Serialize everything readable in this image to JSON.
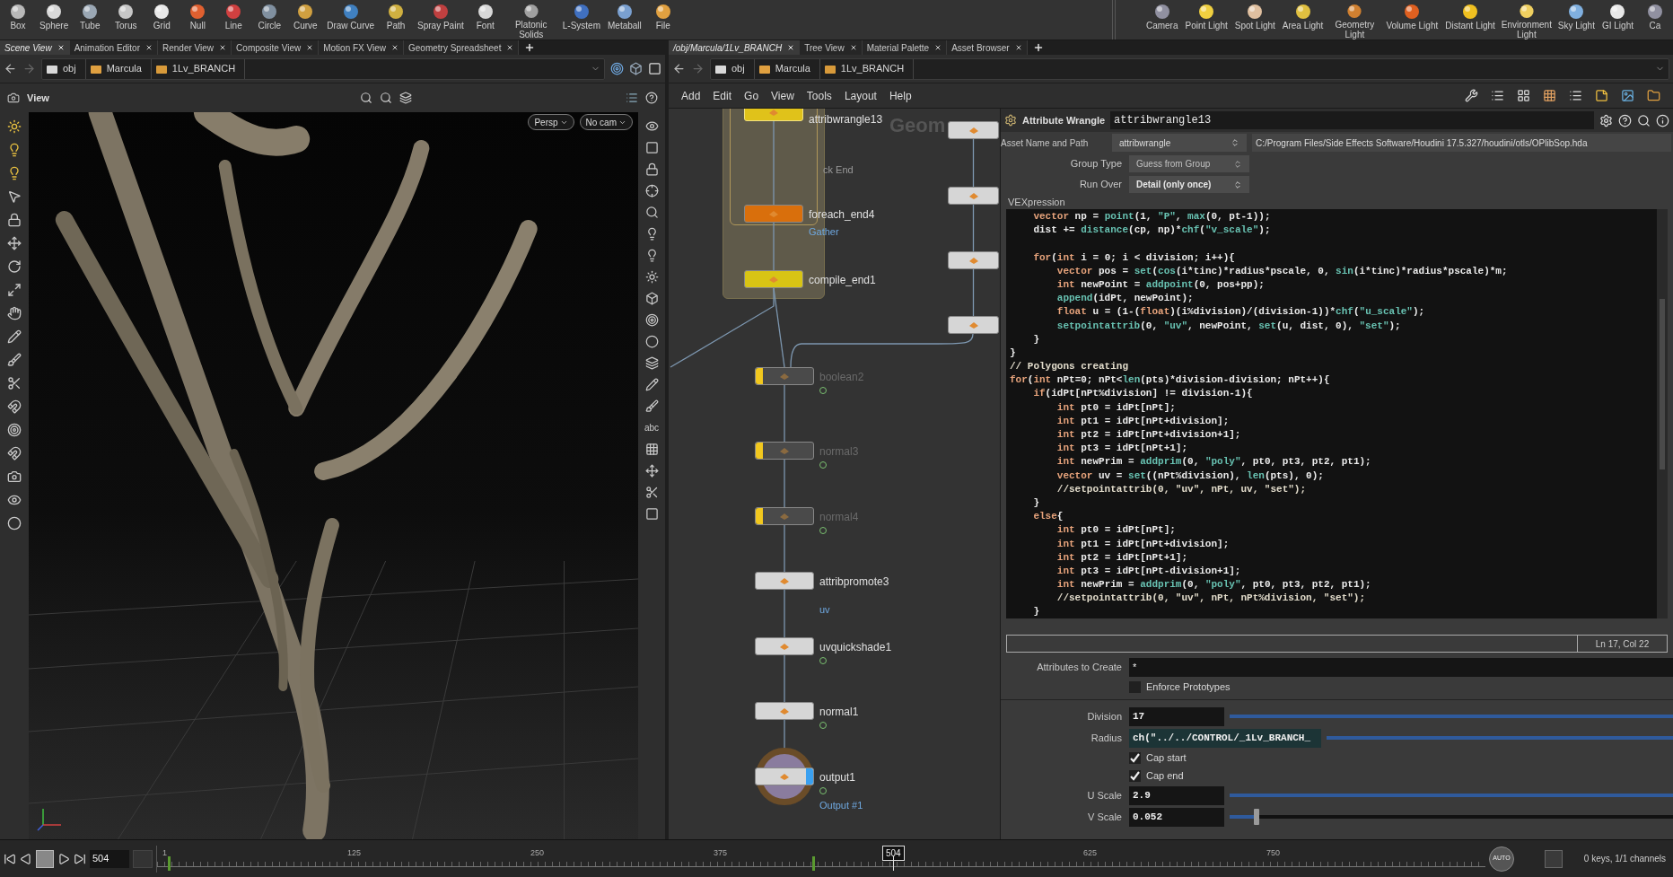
{
  "shelf": {
    "tools": [
      "Box",
      "Sphere",
      "Tube",
      "Torus",
      "Grid",
      "Null",
      "Line",
      "Circle",
      "Curve",
      "Draw Curve",
      "Path",
      "Spray Paint",
      "Font",
      "Platonic Solids",
      "L-System",
      "Metaball",
      "File"
    ],
    "lights": [
      "Camera",
      "Point Light",
      "Spot Light",
      "Area Light",
      "Geometry Light",
      "Volume Light",
      "Distant Light",
      "Environment Light",
      "Sky Light",
      "GI Light",
      "Ca"
    ]
  },
  "scene_view": {
    "tabs": [
      {
        "label": "Scene View",
        "selected": true
      },
      {
        "label": "Animation Editor",
        "selected": false
      },
      {
        "label": "Render View",
        "selected": false
      },
      {
        "label": "Composite View",
        "selected": false
      },
      {
        "label": "Motion FX View",
        "selected": false
      },
      {
        "label": "Geometry Spreadsheet",
        "selected": false
      }
    ],
    "path": [
      "obj",
      "Marcula",
      "1Lv_BRANCH"
    ],
    "pane_title": "View",
    "viewport_buttons": [
      "Persp",
      "No cam"
    ],
    "toolbar_text": "abc"
  },
  "network": {
    "tabs": [
      {
        "label": "/obj/Marcula/1Lv_BRANCH",
        "selected": true
      },
      {
        "label": "Tree View",
        "selected": false
      },
      {
        "label": "Material Palette",
        "selected": false
      },
      {
        "label": "Asset Browser",
        "selected": false
      }
    ],
    "path": [
      "obj",
      "Marcula",
      "1Lv_BRANCH"
    ],
    "menu": [
      "Add",
      "Edit",
      "Go",
      "View",
      "Tools",
      "Layout",
      "Help"
    ],
    "network_title": "Geom",
    "partial_label": "ck End",
    "nodes": [
      {
        "name": "attribwrangle13",
        "color": "#e0c21a",
        "bypassed": false,
        "display": false
      },
      {
        "name": "foreach_end4",
        "sublabel": "Gather",
        "color": "#d96f0c",
        "bypassed": false,
        "display": false
      },
      {
        "name": "compile_end1",
        "color": "#d8c414",
        "bypassed": false,
        "display": false
      },
      {
        "name": "boolean2",
        "color": "#4a4a4a",
        "bypassed": true,
        "display": false
      },
      {
        "name": "normal3",
        "color": "#4a4a4a",
        "bypassed": true,
        "display": false
      },
      {
        "name": "normal4",
        "color": "#4a4a4a",
        "bypassed": true,
        "display": false
      },
      {
        "name": "attribpromote3",
        "sublabel": "uv",
        "color": "#d6d6d6",
        "bypassed": false,
        "display": false
      },
      {
        "name": "uvquickshade1",
        "color": "#d6d6d6",
        "bypassed": false,
        "display": false
      },
      {
        "name": "normal1",
        "color": "#d6d6d6",
        "bypassed": false,
        "display": false
      },
      {
        "name": "output1",
        "sublabel": "Output #1",
        "color": "#d6d6d6",
        "bypassed": false,
        "display": true
      },
      {
        "color": "#d6d6d6",
        "bypassed": false,
        "display": false
      },
      {
        "color": "#d6d6d6",
        "bypassed": false,
        "display": false
      },
      {
        "color": "#d6d6d6",
        "bypassed": false,
        "display": false
      },
      {
        "color": "#d6d6d6",
        "bypassed": false,
        "display": false
      }
    ]
  },
  "parameters": {
    "node_type": "Attribute Wrangle",
    "node_name": "attribwrangle13",
    "asset_label": "Asset Name and Path",
    "asset_name": "attribwrangle",
    "asset_path": "C:/Program Files/Side Effects Software/Houdini 17.5.327/houdini/otls/OPlibSop.hda",
    "fields": [
      {
        "label": "Group Type",
        "value": "Guess from Group"
      },
      {
        "label": "Run Over",
        "value": "Detail (only once)"
      }
    ],
    "code_label": "VEXpression",
    "code": [
      {
        "segments": [
          {
            "text": "    vector",
            "kind": "kw"
          },
          {
            "text": " np = "
          },
          {
            "text": "point",
            "kind": "fn"
          },
          {
            "text": "(1, "
          },
          {
            "text": "\"P\"",
            "kind": "fn"
          },
          {
            "text": ", "
          },
          {
            "text": "max",
            "kind": "fn"
          },
          {
            "text": "(0, pt-1));"
          }
        ]
      },
      {
        "segments": [
          {
            "text": "    dist += "
          },
          {
            "text": "distance",
            "kind": "fn"
          },
          {
            "text": "(cp, np)*"
          },
          {
            "text": "chf",
            "kind": "fn"
          },
          {
            "text": "("
          },
          {
            "text": "\"v_scale\"",
            "kind": "fn"
          },
          {
            "text": ");"
          }
        ]
      },
      {
        "blank_before": true,
        "segments": [
          {
            "text": "    for",
            "kind": "kw"
          },
          {
            "text": "("
          },
          {
            "text": "int",
            "kind": "kw"
          },
          {
            "text": " i = 0; i < division; i++){"
          }
        ]
      },
      {
        "segments": [
          {
            "text": "        vector",
            "kind": "kw"
          },
          {
            "text": " pos = "
          },
          {
            "text": "set",
            "kind": "fn"
          },
          {
            "text": "("
          },
          {
            "text": "cos",
            "kind": "fn"
          },
          {
            "text": "(i*tinc)*radius*pscale, 0, "
          },
          {
            "text": "sin",
            "kind": "fn"
          },
          {
            "text": "(i*tinc)*radius*pscale)*m;"
          }
        ]
      },
      {
        "segments": [
          {
            "text": "        int",
            "kind": "kw"
          },
          {
            "text": " newPoint = "
          },
          {
            "text": "addpoint",
            "kind": "fn"
          },
          {
            "text": "(0, pos+pp);"
          }
        ]
      },
      {
        "segments": [
          {
            "text": "        append",
            "kind": "fn"
          },
          {
            "text": "(idPt, newPoint);"
          }
        ]
      },
      {
        "segments": [
          {
            "text": "        float",
            "kind": "kw"
          },
          {
            "text": " u = (1-("
          },
          {
            "text": "float",
            "kind": "kw"
          },
          {
            "text": ")(i%division)/(division-1))*"
          },
          {
            "text": "chf",
            "kind": "fn"
          },
          {
            "text": "("
          },
          {
            "text": "\"u_scale\"",
            "kind": "fn"
          },
          {
            "text": ");"
          }
        ]
      },
      {
        "segments": [
          {
            "text": "        setpointattrib",
            "kind": "fn"
          },
          {
            "text": "(0, "
          },
          {
            "text": "\"uv\"",
            "kind": "fn"
          },
          {
            "text": ", newPoint, "
          },
          {
            "text": "set",
            "kind": "fn"
          },
          {
            "text": "(u, dist, 0), "
          },
          {
            "text": "\"set\"",
            "kind": "fn"
          },
          {
            "text": ");"
          }
        ]
      },
      {
        "segments": [
          {
            "text": "    }"
          }
        ]
      },
      {
        "segments": [
          {
            "text": "}"
          }
        ]
      },
      {
        "segments": [
          {
            "text": "// Polygons creating",
            "kind": "comment"
          }
        ]
      },
      {
        "segments": [
          {
            "text": "for",
            "kind": "kw"
          },
          {
            "text": "("
          },
          {
            "text": "int",
            "kind": "kw"
          },
          {
            "text": " nPt=0; nPt<"
          },
          {
            "text": "len",
            "kind": "fn"
          },
          {
            "text": "(pts)*division-division; nPt++){"
          }
        ]
      },
      {
        "segments": [
          {
            "text": "    if",
            "kind": "kw"
          },
          {
            "text": "(idPt[nPt%division] != division-1){"
          }
        ]
      },
      {
        "segments": [
          {
            "text": "        int",
            "kind": "kw"
          },
          {
            "text": " pt0 = idPt[nPt];"
          }
        ]
      },
      {
        "segments": [
          {
            "text": "        int",
            "kind": "kw"
          },
          {
            "text": " pt1 = idPt[nPt+division];"
          }
        ]
      },
      {
        "segments": [
          {
            "text": "        int",
            "kind": "kw"
          },
          {
            "text": " pt2 = idPt[nPt+division+1];"
          }
        ]
      },
      {
        "segments": [
          {
            "text": "        int",
            "kind": "kw"
          },
          {
            "text": " pt3 = idPt[nPt+1];"
          }
        ]
      },
      {
        "segments": [
          {
            "text": "        int",
            "kind": "kw"
          },
          {
            "text": " newPrim = "
          },
          {
            "text": "addprim",
            "kind": "fn"
          },
          {
            "text": "(0, "
          },
          {
            "text": "\"poly\"",
            "kind": "fn"
          },
          {
            "text": ", pt0, pt3, pt2, pt1);"
          }
        ]
      },
      {
        "segments": [
          {
            "text": "        vector",
            "kind": "kw"
          },
          {
            "text": " uv = "
          },
          {
            "text": "set",
            "kind": "fn"
          },
          {
            "text": "((nPt%division), "
          },
          {
            "text": "len",
            "kind": "fn"
          },
          {
            "text": "(pts), 0);"
          }
        ]
      },
      {
        "segments": [
          {
            "text": "        //setpointattrib(0, \"uv\", nPt, uv, \"set\");",
            "kind": "comment"
          }
        ]
      },
      {
        "segments": [
          {
            "text": "    }"
          }
        ]
      },
      {
        "segments": [
          {
            "text": "    else",
            "kind": "kw"
          },
          {
            "text": "{"
          }
        ]
      },
      {
        "segments": [
          {
            "text": "        int",
            "kind": "kw"
          },
          {
            "text": " pt0 = idPt[nPt];"
          }
        ]
      },
      {
        "segments": [
          {
            "text": "        int",
            "kind": "kw"
          },
          {
            "text": " pt1 = idPt[nPt+division];"
          }
        ]
      },
      {
        "segments": [
          {
            "text": "        int",
            "kind": "kw"
          },
          {
            "text": " pt2 = idPt[nPt+1];"
          }
        ]
      },
      {
        "segments": [
          {
            "text": "        int",
            "kind": "kw"
          },
          {
            "text": " pt3 = idPt[nPt-division+1];"
          }
        ]
      },
      {
        "segments": [
          {
            "text": "        int",
            "kind": "kw"
          },
          {
            "text": " newPrim = "
          },
          {
            "text": "addprim",
            "kind": "fn"
          },
          {
            "text": "(0, "
          },
          {
            "text": "\"poly\"",
            "kind": "fn"
          },
          {
            "text": ", pt0, pt3, pt2, pt1);"
          }
        ]
      },
      {
        "segments": [
          {
            "text": "        //setpointattrib(0, \"uv\", nPt, nPt%division, \"set\");",
            "kind": "comment"
          }
        ]
      },
      {
        "segments": [
          {
            "text": "    }"
          }
        ]
      }
    ],
    "cursor": "Ln 17, Col 22",
    "attributes_label": "Attributes to Create",
    "attributes_value": "*",
    "enforce": {
      "label": "Enforce Prototypes",
      "checked": false
    },
    "params": [
      {
        "kind": "slider",
        "label": "Division",
        "value": "17",
        "level": 1,
        "expression": false
      },
      {
        "kind": "slider",
        "label": "Radius",
        "value": "ch(\"../../CONTROL/_1Lv_BRANCH_",
        "level": 1,
        "expression": true
      },
      {
        "kind": "checkbox",
        "label": "Cap start",
        "checked": true
      },
      {
        "kind": "checkbox",
        "label": "Cap end",
        "checked": true
      },
      {
        "kind": "slider",
        "label": "U Scale",
        "value": "2.9",
        "level": 1,
        "expression": false
      },
      {
        "kind": "slider",
        "label": "V Scale",
        "value": "0.052",
        "level": 0.06,
        "expression": false
      }
    ]
  },
  "timeline": {
    "frame": "504",
    "ticks": [
      "1",
      "125",
      "250",
      "375",
      "625",
      "750"
    ],
    "current": "504",
    "auto": "AUTO",
    "keys": "0 keys, 1/1 channels"
  }
}
